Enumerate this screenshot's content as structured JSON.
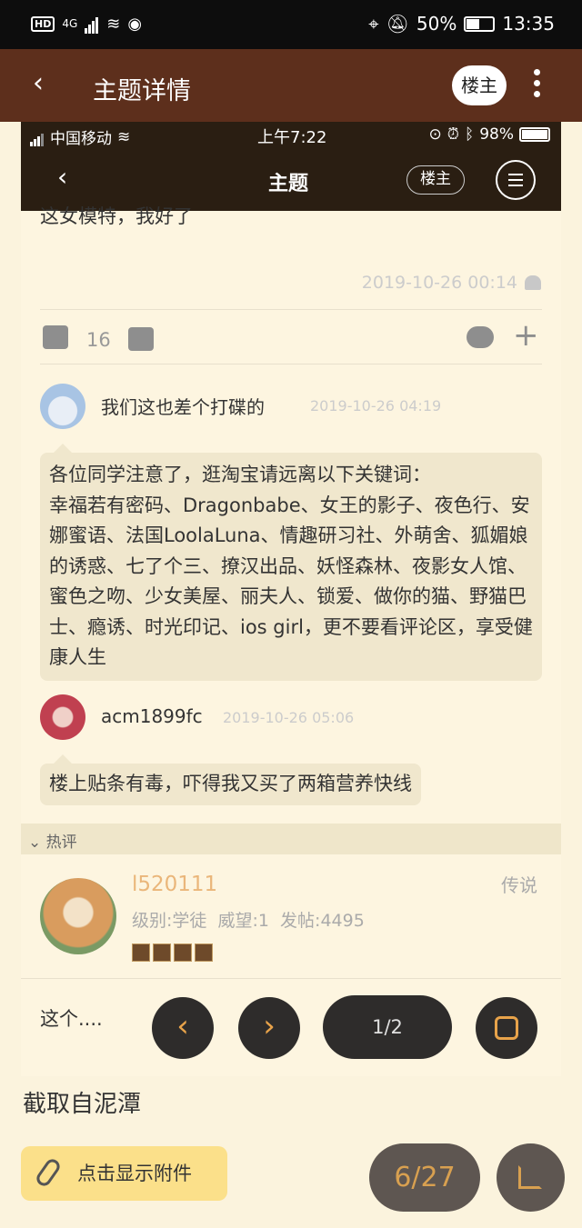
{
  "status_bar": {
    "hd": "HD",
    "network": "4G",
    "battery": "50%",
    "time": "13:35"
  },
  "app_header": {
    "title": "主题详情",
    "op_button": "楼主",
    "back_icon": "‹"
  },
  "inner": {
    "status": {
      "carrier": "中国移动",
      "time": "上午7:22",
      "battery": "98%"
    },
    "header": {
      "title": "主题",
      "op_button": "楼主"
    },
    "post": {
      "text_cut": "这女模特，我好了",
      "date": "2019-10-26 00:14"
    },
    "actions": {
      "likes": "16"
    },
    "comments": [
      {
        "user": "我们这也差个打碟的",
        "date": "2019-10-26 04:19",
        "text": "各位同学注意了，逛淘宝请远离以下关键词：\n幸福若有密码、Dragonbabe、女王的影子、夜色行、安娜蜜语、法国LoolaLuna、情趣研习社、外萌舍、狐媚娘的诱惑、七了个三、撩汉出品、妖怪森林、夜影女人馆、蜜色之吻、少女美屋、丽夫人、锁爱、做你的猫、野猫巴士、瘾诱、时光印记、ios girl，更不要看评论区，享受健康人生"
      },
      {
        "user": "acm1899fc",
        "date": "2019-10-26 05:06",
        "text": "楼上贴条有毒，吓得我又买了两箱营养快线"
      }
    ],
    "hot": {
      "label": "热评",
      "user": "l520111",
      "rank": "传说",
      "meta": "级别:学徒  威望:1  发帖:4495"
    },
    "bottom": {
      "reply": "这个....",
      "pager": "1/2"
    }
  },
  "source_text": "截取自泥潭",
  "attachment_button": "点击显示附件",
  "page_counter": "6/27"
}
